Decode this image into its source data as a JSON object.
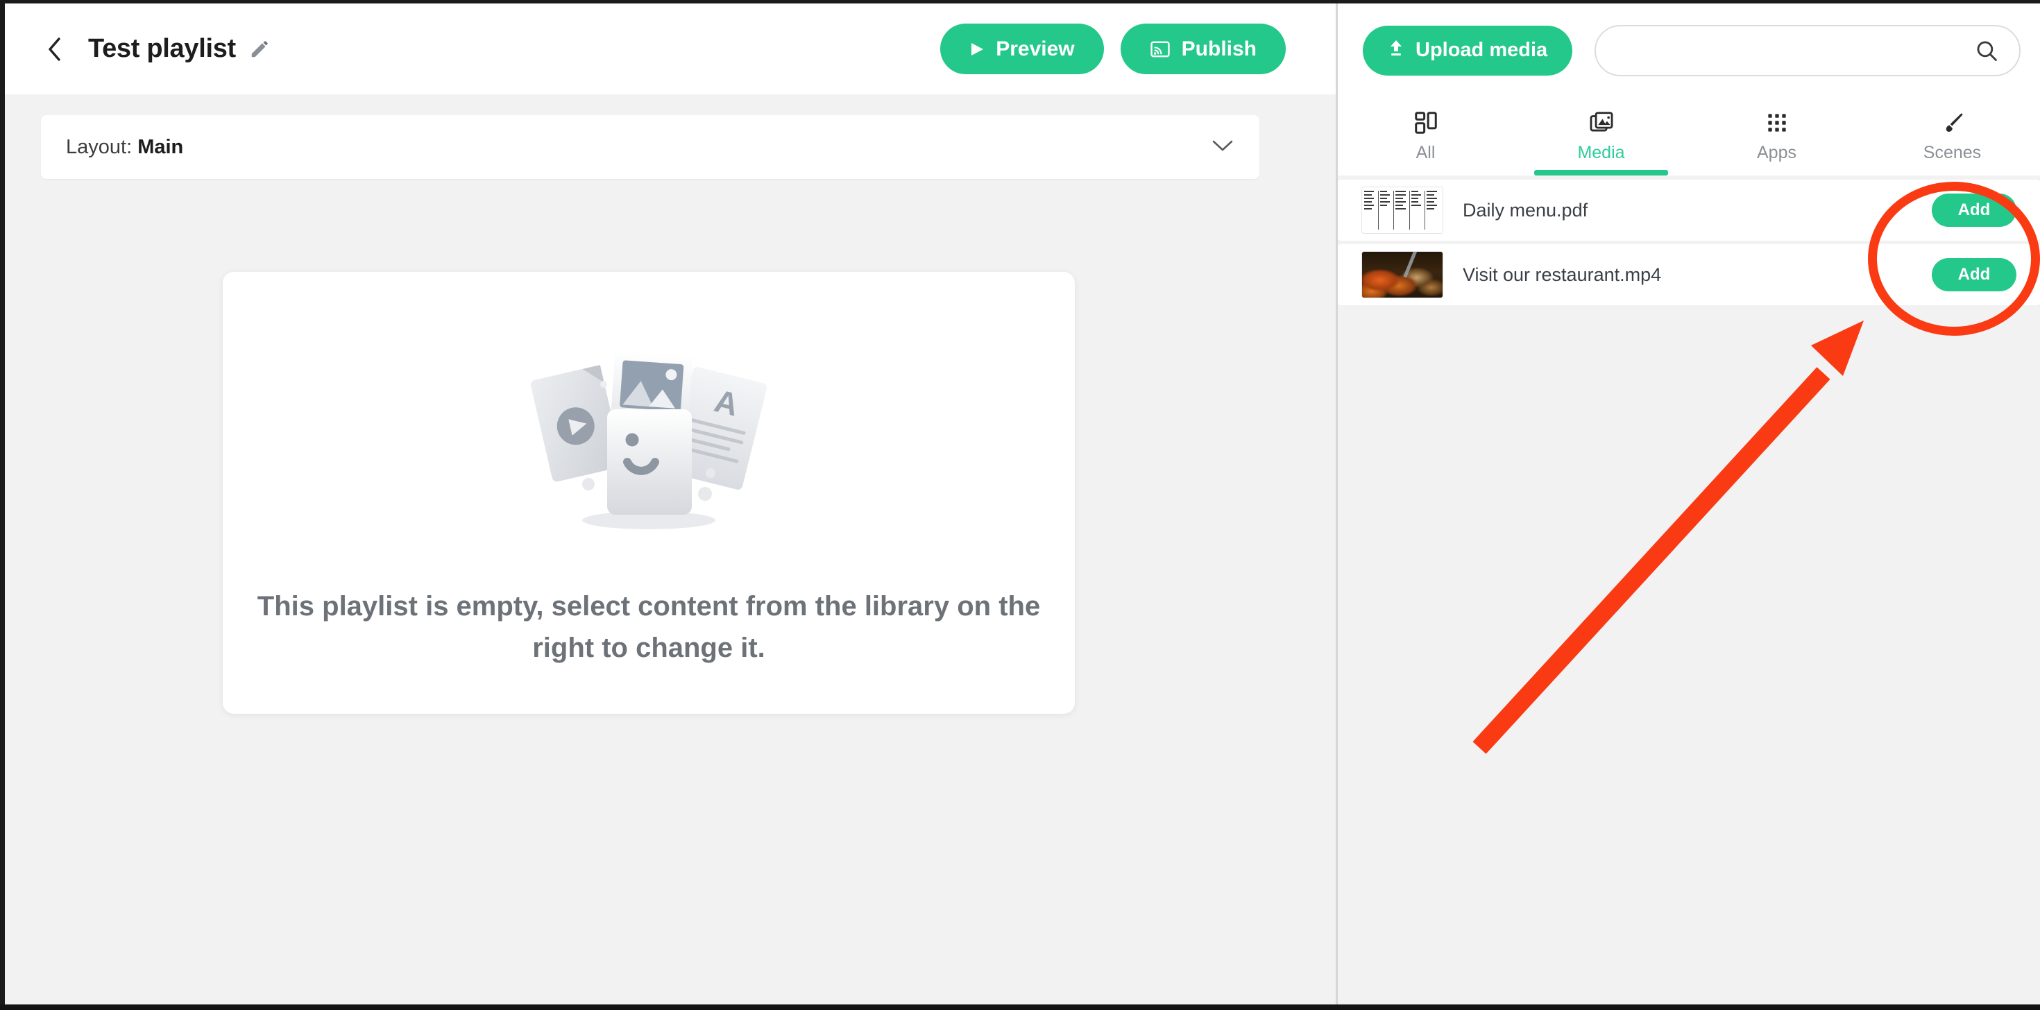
{
  "left": {
    "back_icon": "chevron-left-icon",
    "title": "Test playlist",
    "edit_icon": "pencil-icon",
    "preview_label": "Preview",
    "preview_icon": "play-icon",
    "publish_label": "Publish",
    "publish_icon": "cast-screen-icon",
    "layout_prefix": "Layout:",
    "layout_value": "Main",
    "layout_chevron_icon": "chevron-down-icon",
    "empty_illustration": "media-cards-smiley-illustration",
    "empty_message": "This playlist is empty, select content from the library on the right to change it."
  },
  "right": {
    "upload_label": "Upload media",
    "upload_icon": "upload-arrow-icon",
    "search_value": "",
    "search_placeholder": "",
    "search_icon": "search-icon",
    "tabs": [
      {
        "label": "All",
        "icon": "grid-layout-icon",
        "active": false
      },
      {
        "label": "Media",
        "icon": "photo-stack-icon",
        "active": true
      },
      {
        "label": "Apps",
        "icon": "dots-grid-icon",
        "active": false
      },
      {
        "label": "Scenes",
        "icon": "paint-brush-icon",
        "active": false
      }
    ],
    "items": [
      {
        "name": "Daily menu.pdf",
        "thumb": "pdf-menu-thumbnail",
        "add_label": "Add"
      },
      {
        "name": "Visit our restaurant.mp4",
        "thumb": "food-video-thumbnail",
        "add_label": "Add"
      }
    ]
  },
  "annotations": {
    "ellipse": "highlight-ellipse-around-add-buttons",
    "arrow": "arrow-pointing-to-add-buttons",
    "color": "#F93A13"
  },
  "colors": {
    "accent_green": "#24C88A",
    "tab_active_green": "#2ECC9B",
    "panel_bg": "#F2F2F3",
    "card_bg": "#FFFFFF",
    "empty_text": "#6D7278"
  }
}
